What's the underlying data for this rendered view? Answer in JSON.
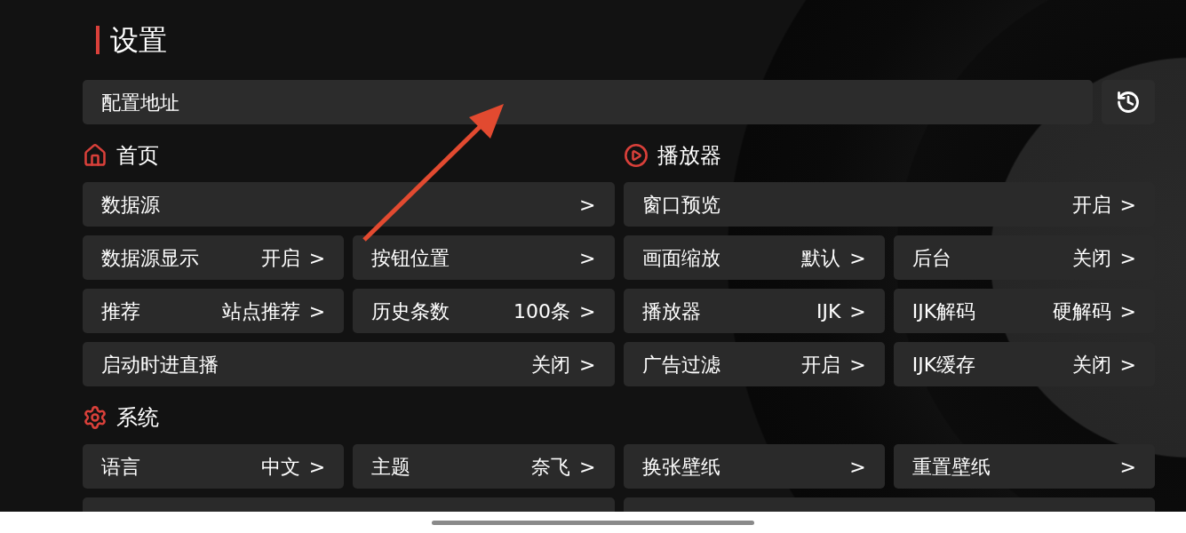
{
  "title": "设置",
  "config": {
    "placeholder": "配置地址"
  },
  "sections": [
    {
      "title": "首页",
      "items": [
        {
          "kind": "wide",
          "label": "数据源",
          "chevron": ">"
        },
        {
          "kind": "half",
          "label": "数据源显示",
          "value": "开启",
          "chevron": ">"
        },
        {
          "kind": "half",
          "label": "按钮位置",
          "chevron": ">"
        },
        {
          "kind": "half",
          "label": "推荐",
          "value": "站点推荐",
          "chevron": ">"
        },
        {
          "kind": "half",
          "label": "历史条数",
          "value": "100条",
          "chevron": ">"
        },
        {
          "kind": "wide",
          "label": "启动时进直播",
          "value": "关闭",
          "chevron": ">"
        }
      ]
    },
    {
      "title": "播放器",
      "items": [
        {
          "kind": "wide",
          "label": "窗口预览",
          "value": "开启",
          "chevron": ">"
        },
        {
          "kind": "half",
          "label": "画面缩放",
          "value": "默认",
          "chevron": ">"
        },
        {
          "kind": "half",
          "label": "后台",
          "value": "关闭",
          "chevron": ">"
        },
        {
          "kind": "half",
          "label": "播放器",
          "value": "IJK",
          "chevron": ">"
        },
        {
          "kind": "half",
          "label": "IJK解码",
          "value": "硬解码",
          "chevron": ">"
        },
        {
          "kind": "half",
          "label": "广告过滤",
          "value": "开启",
          "chevron": ">"
        },
        {
          "kind": "half",
          "label": "IJK缓存",
          "value": "关闭",
          "chevron": ">"
        }
      ]
    },
    {
      "title": "系统",
      "items": [
        {
          "kind": "half",
          "label": "语言",
          "value": "中文",
          "chevron": ">"
        },
        {
          "kind": "half",
          "label": "主题",
          "value": "奈飞",
          "chevron": ">"
        },
        {
          "kind": "half",
          "label": "换张壁纸",
          "chevron": ">"
        },
        {
          "kind": "half",
          "label": "重置壁纸",
          "chevron": ">"
        },
        {
          "kind": "cut"
        },
        {
          "kind": "cut"
        }
      ]
    }
  ]
}
